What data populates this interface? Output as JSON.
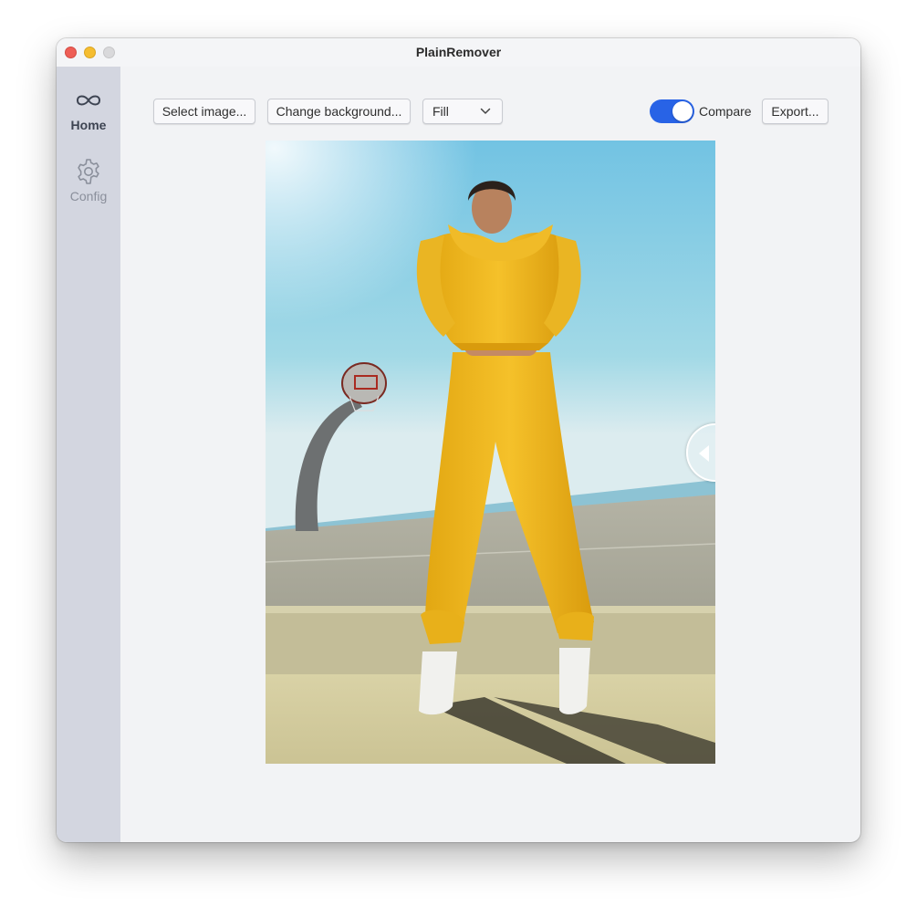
{
  "window": {
    "title": "PlainRemover"
  },
  "sidebar": {
    "items": [
      {
        "label": "Home",
        "icon": "infinity-icon",
        "active": true
      },
      {
        "label": "Config",
        "icon": "gear-icon",
        "active": false
      }
    ]
  },
  "toolbar": {
    "select_image_label": "Select image...",
    "change_background_label": "Change background...",
    "fill_mode": {
      "selected": "Fill"
    },
    "compare": {
      "label": "Compare",
      "enabled": true
    },
    "export_label": "Export..."
  },
  "colors": {
    "accent": "#2863e6",
    "sidebar_bg": "#d3d6e0",
    "content_bg": "#f2f3f5"
  }
}
